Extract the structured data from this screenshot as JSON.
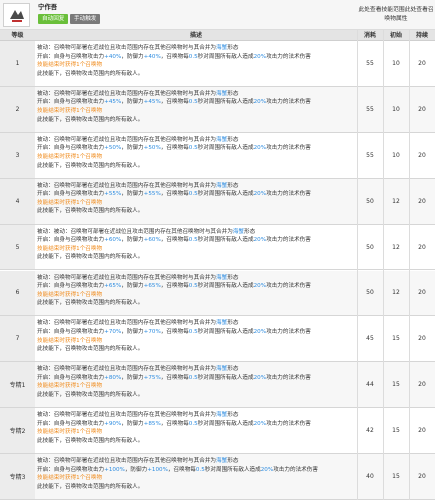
{
  "skill": {
    "name": "宁作吾",
    "tag_auto": "自动回复",
    "tag_manual": "手动触发",
    "range_note": "此处查看技能范围此处查看召唤物属性"
  },
  "table": {
    "headers": [
      "等级",
      "描述",
      "消耗",
      "初始",
      "持续"
    ],
    "rows": [
      {
        "level": "1",
        "passive": "被动：召唤物可部署在近战位且攻击范围内存在其他召唤物时与其合并为",
        "form": "海蟹",
        "form_suffix": "形态",
        "active_a": "开启：自身与召唤物攻击力",
        "atk": "+40%",
        "active_b": "，防御力",
        "def": "+40%",
        "active_c": "，召唤物每",
        "sec": "0.5",
        "active_d": "秒对周围所有敌人造成",
        "dmg": "20%",
        "active_e": "攻击力的法术伤害",
        "note": "技能结束时获得1个召唤物",
        "tail": "此技能下，召唤物攻击范围内的所有敌人。",
        "cost": "55",
        "init": "10",
        "dur": "20"
      },
      {
        "level": "2",
        "passive": "被动：召唤物可部署在近战位且攻击范围内存在其他召唤物时与其合并为",
        "form": "海蟹",
        "form_suffix": "形态",
        "active_a": "开启：自身与召唤物攻击力",
        "atk": "+45%",
        "active_b": "，防御力",
        "def": "+45%",
        "active_c": "，召唤物每",
        "sec": "0.5",
        "active_d": "秒对周围所有敌人造成",
        "dmg": "20%",
        "active_e": "攻击力的法术伤害",
        "note": "技能结束时获得1个召唤物",
        "tail": "此技能下，召唤物攻击范围内的所有敌人。",
        "cost": "55",
        "init": "10",
        "dur": "20"
      },
      {
        "level": "3",
        "passive": "被动：召唤物可部署在近战位且攻击范围内存在其他召唤物时与其合并为",
        "form": "海蟹",
        "form_suffix": "形态",
        "active_a": "开启：自身与召唤物攻击力",
        "atk": "+50%",
        "active_b": "，防御力",
        "def": "+50%",
        "active_c": "，召唤物每",
        "sec": "0.5",
        "active_d": "秒对周围所有敌人造成",
        "dmg": "20%",
        "active_e": "攻击力的法术伤害",
        "note": "技能结束时获得1个召唤物",
        "tail": "此技能下，召唤物攻击范围内的所有敌人。",
        "cost": "55",
        "init": "10",
        "dur": "20"
      },
      {
        "level": "4",
        "passive": "被动：召唤物可部署在近战位且攻击范围内存在其他召唤物时与其合并为",
        "form": "海蟹",
        "form_suffix": "形态",
        "active_a": "开启：自身与召唤物攻击力",
        "atk": "+55%",
        "active_b": "，防御力",
        "def": "+55%",
        "active_c": "，召唤物每",
        "sec": "0.5",
        "active_d": "秒对周围所有敌人造成",
        "dmg": "20%",
        "active_e": "攻击力的法术伤害",
        "note": "技能结束时获得1个召唤物",
        "tail": "此技能下，召唤物攻击范围内的所有敌人。",
        "cost": "50",
        "init": "12",
        "dur": "20"
      },
      {
        "level": "5",
        "passive": "被动：被动：召唤物可部署在近战位且攻击范围内存在其他召唤物时与其合并为",
        "form": "海蟹",
        "form_suffix": "形态",
        "active_a": "开启：自身与召唤物攻击力",
        "atk": "+60%",
        "active_b": "，防御力",
        "def": "+60%",
        "active_c": "，召唤物每",
        "sec": "0.5",
        "active_d": "秒对周围所有敌人造成",
        "dmg": "20%",
        "active_e": "攻击力的法术伤害",
        "note": "技能结束时获得1个召唤物",
        "tail": "此技能下，召唤物攻击范围内的所有敌人。",
        "cost": "50",
        "init": "12",
        "dur": "20"
      },
      {
        "level": "6",
        "passive": "被动：召唤物可部署在近战位且攻击范围内存在其他召唤物时与其合并为",
        "form": "海蟹",
        "form_suffix": "形态",
        "active_a": "开启：自身与召唤物攻击力",
        "atk": "+65%",
        "active_b": "，防御力",
        "def": "+65%",
        "active_c": "，召唤物每",
        "sec": "0.5",
        "active_d": "秒对周围所有敌人造成",
        "dmg": "20%",
        "active_e": "攻击力的法术伤害",
        "note": "技能结束时获得1个召唤物",
        "tail": "此技能下，召唤物攻击范围内的所有敌人。",
        "cost": "50",
        "init": "12",
        "dur": "20"
      },
      {
        "level": "7",
        "passive": "被动：召唤物可部署在近战位且攻击范围内存在其他召唤物时与其合并为",
        "form": "海蟹",
        "form_suffix": "形态",
        "active_a": "开启：自身与召唤物攻击力",
        "atk": "+70%",
        "active_b": "，防御力",
        "def": "+70%",
        "active_c": "，召唤物每",
        "sec": "0.5",
        "active_d": "秒对周围所有敌人造成",
        "dmg": "20%",
        "active_e": "攻击力的法术伤害",
        "note": "技能结束时获得1个召唤物",
        "tail": "此技能下，召唤物攻击范围内的所有敌人。",
        "cost": "45",
        "init": "15",
        "dur": "20"
      },
      {
        "level": "专精1",
        "passive": "被动：召唤物可部署在近战位且攻击范围内存在其他召唤物时与其合并为",
        "form": "海蟹",
        "form_suffix": "形态",
        "active_a": "开启：自身与召唤物攻击力",
        "atk": "+80%",
        "active_b": "，防御力",
        "def": "+75%",
        "active_c": "，召唤物每",
        "sec": "0.5",
        "active_d": "秒对周围所有敌人造成",
        "dmg": "20%",
        "active_e": "攻击力的法术伤害",
        "note": "技能结束时获得1个召唤物",
        "tail": "此技能下，召唤物攻击范围内的所有敌人。",
        "cost": "44",
        "init": "15",
        "dur": "20"
      },
      {
        "level": "专精2",
        "passive": "被动：召唤物可部署在近战位且攻击范围内存在其他召唤物时与其合并为",
        "form": "海蟹",
        "form_suffix": "形态",
        "active_a": "开启：自身与召唤物攻击力",
        "atk": "+90%",
        "active_b": "，防御力",
        "def": "+85%",
        "active_c": "，召唤物每",
        "sec": "0.5",
        "active_d": "秒对周围所有敌人造成",
        "dmg": "20%",
        "active_e": "攻击力的法术伤害",
        "note": "技能结束时获得1个召唤物",
        "tail": "此技能下，召唤物攻击范围内的所有敌人。",
        "cost": "42",
        "init": "15",
        "dur": "20"
      },
      {
        "level": "专精3",
        "passive": "被动：召唤物可部署在近战位且攻击范围内存在其他召唤物时与其合并为",
        "form": "海蟹",
        "form_suffix": "形态",
        "active_a": "开启：自身与召唤物攻击力",
        "atk": "+100%",
        "active_b": "，防御力",
        "def": "+100%",
        "active_c": "，召唤物每",
        "sec": "0.5",
        "active_d": "秒对周围所有敌人造成",
        "dmg": "20%",
        "active_e": "攻击力的法术伤害",
        "note": "技能结束时获得1个召唤物",
        "tail": "此技能下，召唤物攻击范围内的所有敌人。",
        "cost": "40",
        "init": "15",
        "dur": "20"
      }
    ]
  },
  "colors": {
    "highlight_blue": "#2d8ce0",
    "highlight_orange": "#f08c1e",
    "tag_green": "#6abf3a"
  }
}
